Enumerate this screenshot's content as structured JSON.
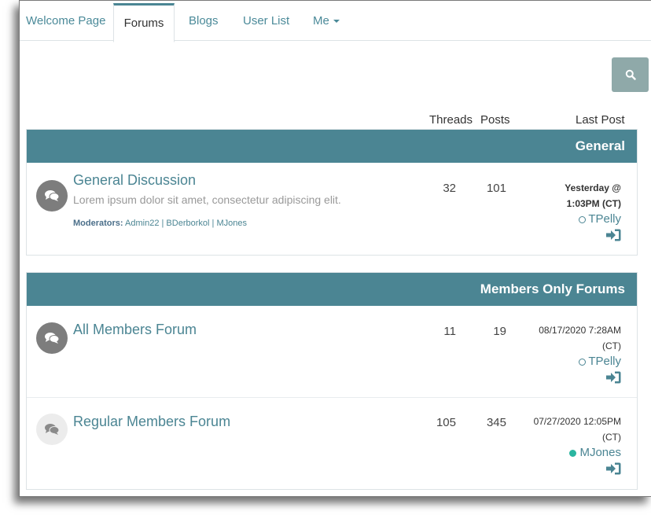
{
  "nav": {
    "tabs": [
      {
        "label": "Welcome Page"
      },
      {
        "label": "Forums"
      },
      {
        "label": "Blogs"
      },
      {
        "label": "User List"
      },
      {
        "label": "Me"
      }
    ]
  },
  "columns": {
    "threads": "Threads",
    "posts": "Posts",
    "last_post": "Last Post"
  },
  "sections": [
    {
      "title": "General",
      "forums": [
        {
          "title": "General Discussion",
          "description": "Lorem ipsum dolor sit amet, consectetur adipiscing elit.",
          "moderators_label": "Moderators:",
          "moderators": [
            "Admin22",
            "BDerborkol",
            "MJones"
          ],
          "threads": "32",
          "posts": "101",
          "last_post_line1": "Yesterday @",
          "last_post_line2": "1:03PM (CT)",
          "last_user": "TPelly",
          "last_user_online": false
        }
      ]
    },
    {
      "title": "Members Only Forums",
      "forums": [
        {
          "title": "All Members Forum",
          "threads": "11",
          "posts": "19",
          "last_post_line1": "08/17/2020 7:28AM",
          "last_post_line2": "(CT)",
          "last_user": "TPelly",
          "last_user_online": false
        },
        {
          "title": "Regular Members Forum",
          "threads": "105",
          "posts": "345",
          "last_post_line1": "07/27/2020 12:05PM",
          "last_post_line2": "(CT)",
          "last_user": "MJones",
          "last_user_online": true
        }
      ]
    }
  ],
  "colors": {
    "accent": "#4b8593",
    "search_button": "#8fa9a9",
    "online": "#2ab5a0"
  },
  "icons": {
    "search": "search-icon",
    "forum": "comments-icon",
    "goto": "sign-in-icon",
    "menu": "caret-down-icon"
  }
}
